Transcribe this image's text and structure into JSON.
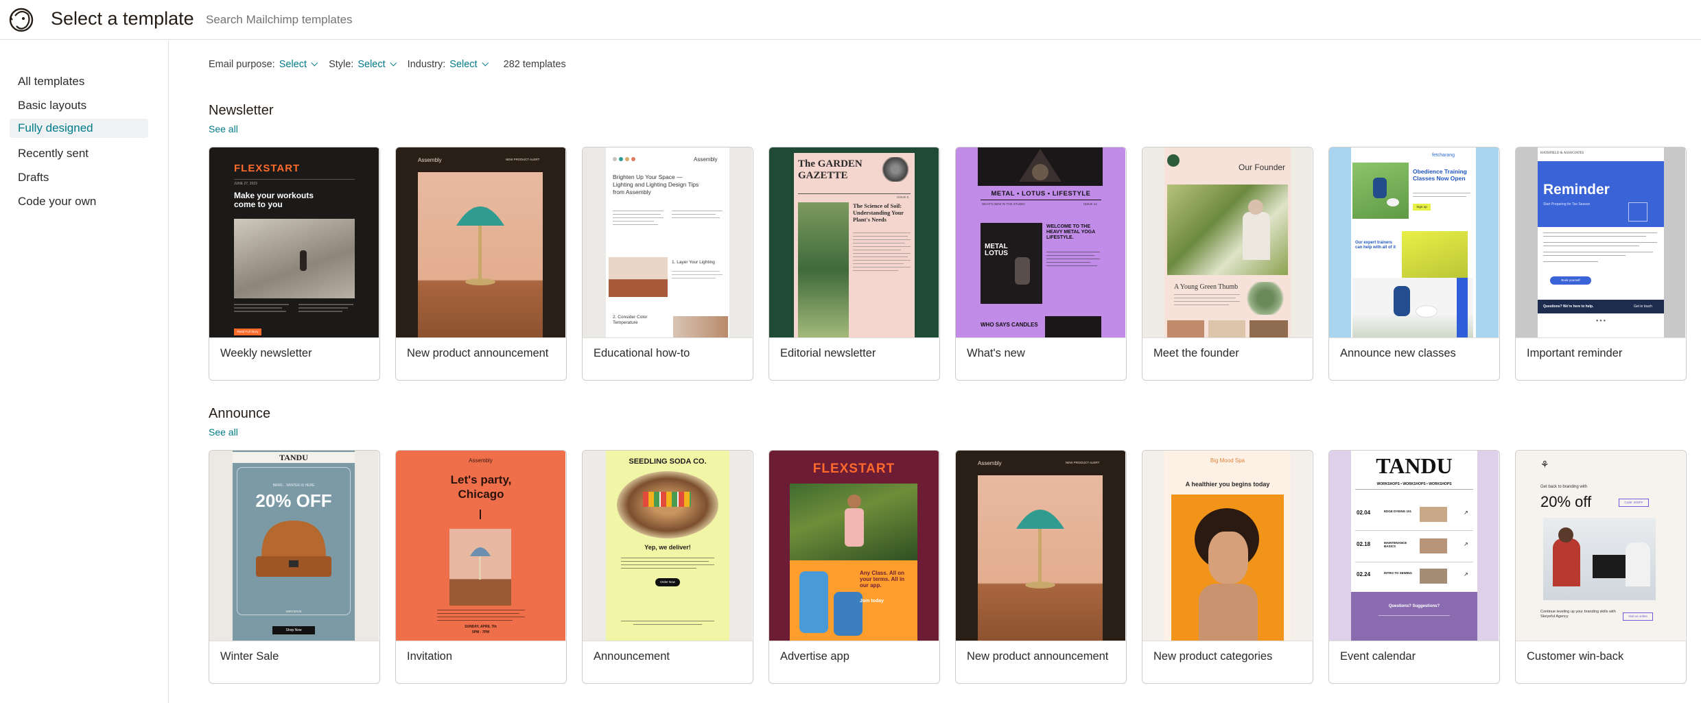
{
  "header": {
    "title": "Select a template",
    "search_placeholder": "Search Mailchimp templates"
  },
  "sidebar": {
    "items": [
      {
        "label": "All templates",
        "active": false
      },
      {
        "label": "Basic layouts",
        "active": false
      },
      {
        "label": "Fully designed",
        "active": true
      },
      {
        "label": "Recently sent",
        "active": false
      },
      {
        "label": "Drafts",
        "active": false
      },
      {
        "label": "Code your own",
        "active": false
      }
    ]
  },
  "filters": {
    "email_purpose_label": "Email purpose:",
    "email_purpose_value": "Select",
    "style_label": "Style:",
    "style_value": "Select",
    "industry_label": "Industry:",
    "industry_value": "Select",
    "count": "282 templates"
  },
  "colors": {
    "accent": "#007c89",
    "sidebar_active_bg": "#eef2f3",
    "border": "#cfcdca"
  },
  "sections": [
    {
      "title": "Newsletter",
      "see_all": "See all",
      "cards": [
        {
          "label": "Weekly newsletter",
          "thumb": {
            "brand": "FLEXSTART",
            "date": "JUNE 27, 2023",
            "headline": "Make your workouts come to you",
            "cta": "Read Full Story"
          }
        },
        {
          "label": "New product announcement",
          "thumb": {
            "brand": "Assembly",
            "nav": "NEW PRODUCT ALERT"
          }
        },
        {
          "label": "Educational how-to",
          "thumb": {
            "brand": "Assembly",
            "headline": "Brighten Up Your Space — Lighting and Lighting Design Tips from Assembly",
            "step1": "1. Layer Your Lighting",
            "step2": "2. Consider Color Temperature"
          }
        },
        {
          "label": "Editorial newsletter",
          "thumb": {
            "title": "The GARDEN GAZETTE",
            "headline": "The Science of Soil: Understanding Your Plant's Needs",
            "issue": "ISSUE 5"
          }
        },
        {
          "label": "What's new",
          "thumb": {
            "headline": "METAL • LOTUS • LIFESTYLE",
            "subhead": "WHAT'S NEW IN THE STUDIO",
            "issue": "ISSUE 14",
            "card_title": "METAL LOTUS",
            "promo": "WELCOME TO THE HEAVY METAL YOGA LIFESTYLE.",
            "footer": "WHO SAYS CANDLES"
          }
        },
        {
          "label": "Meet the founder",
          "thumb": {
            "headline": "Our Founder",
            "caption": "A Young Green Thumb"
          }
        },
        {
          "label": "Announce new classes",
          "thumb": {
            "brand": "fetcharang",
            "headline": "Obedience Training Classes Now Open",
            "cta": "Sign up",
            "aside": "Our expert trainers can help with all of it"
          }
        },
        {
          "label": "Important reminder",
          "thumb": {
            "brand": "HATHFIELD & ASSOCIATES",
            "headline": "Reminder",
            "subhead": "Start Preparing for Tax Season",
            "cta": "Book yourself",
            "footer": "Questions? We're here to help.",
            "footer_cta": "Get in touch"
          }
        }
      ]
    },
    {
      "title": "Announce",
      "see_all": "See all",
      "cards": [
        {
          "label": "Winter Sale",
          "thumb": {
            "brand": "TANDU",
            "kicker": "BRRR... WINTER IS HERE",
            "headline": "20% OFF",
            "code": "WINTER20",
            "cta": "Shop Now"
          }
        },
        {
          "label": "Invitation",
          "thumb": {
            "brand": "Assembly",
            "headline": "Let's party, Chicago",
            "when": "SUNDAY, APRIL 7th",
            "time": "5PM - 7PM"
          }
        },
        {
          "label": "Announcement",
          "thumb": {
            "brand": "SEEDLING SODA CO.",
            "headline": "Yep, we deliver!",
            "cta": "Order Now"
          }
        },
        {
          "label": "Advertise app",
          "thumb": {
            "brand": "FLEXSTART",
            "headline": "Any Class. All on your terms. All in our app.",
            "cta": "Join today"
          }
        },
        {
          "label": "New product announcement",
          "thumb": {
            "brand": "Assembly",
            "nav": "NEW PRODUCT ALERT"
          }
        },
        {
          "label": "New product categories",
          "thumb": {
            "brand": "Big Mood Spa",
            "headline": "A healthier you begins today"
          }
        },
        {
          "label": "Event calendar",
          "thumb": {
            "brand": "TANDU",
            "ticker": "WORKSHOPS • WORKSHOPS • WORKSHOPS",
            "events": [
              {
                "date": "02.04",
                "title": "EDGE DYEING 101"
              },
              {
                "date": "02.18",
                "title": "MAINTENANCE BASICS"
              },
              {
                "date": "02.24",
                "title": "INTRO TO SEWING"
              }
            ],
            "footer": "Questions? Suggestions?"
          }
        },
        {
          "label": "Customer win-back",
          "thumb": {
            "kicker": "Get back to branding with",
            "headline": "20% off",
            "badge": "Code: 20OFF",
            "body": "Continue leveling up your branding skills with Skeyeful Agency",
            "cta": "Visit us online"
          }
        }
      ]
    }
  ]
}
